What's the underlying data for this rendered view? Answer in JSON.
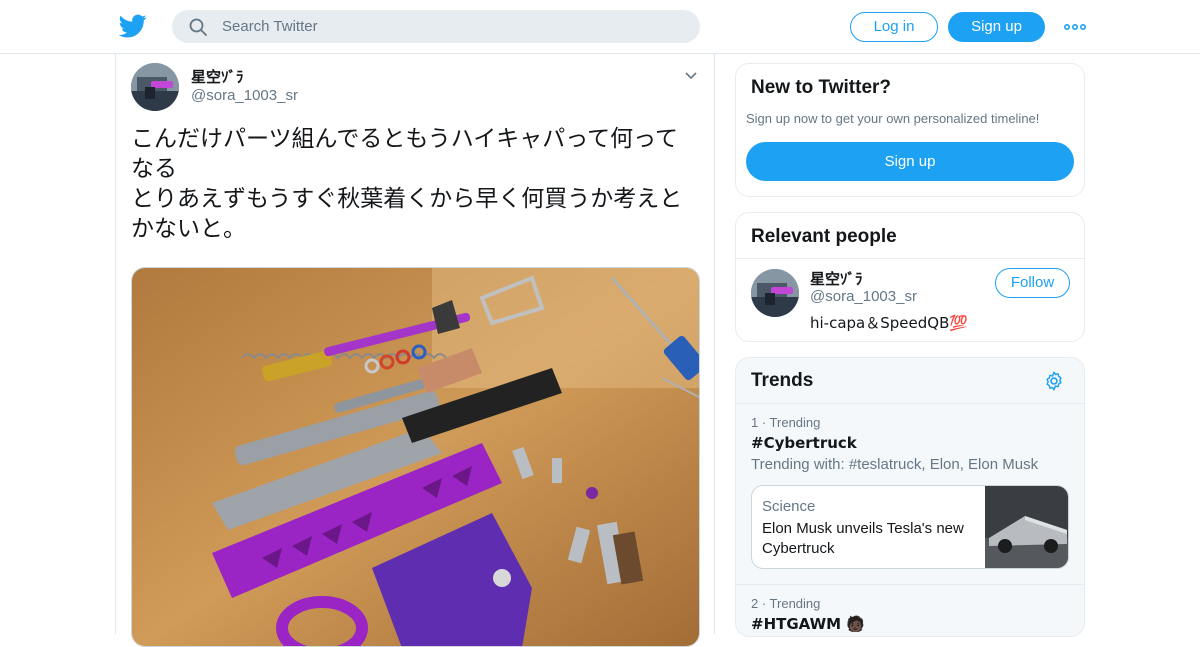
{
  "header": {
    "search_placeholder": "Search Twitter",
    "login_label": "Log in",
    "signup_label": "Sign up",
    "brand_color": "#1da1f2"
  },
  "tweet": {
    "name": "星空ｿﾞﾗ",
    "handle": "@sora_1003_sr",
    "text": "こんだけパーツ組んでるともうハイキャパって何ってなる\nとりあえずもうすぐ秋葉着くから早く何買うか考えとかないと。",
    "photo": "photo of disassembled airsoft pistol parts with purple frame and slide on a wooden table"
  },
  "new_to_twitter": {
    "title": "New to Twitter?",
    "subtitle": "Sign up now to get your own personalized timeline!",
    "button": "Sign up"
  },
  "relevant_people": {
    "title": "Relevant people",
    "name": "星空ｿﾞﾗ",
    "handle": "@sora_1003_sr",
    "bio": "hi-capa＆SpeedQB💯",
    "follow_label": "Follow"
  },
  "trends": {
    "title": "Trends",
    "items": [
      {
        "meta": "1 · Trending",
        "tag": "#Cybertruck",
        "with": "Trending with: #teslatruck, Elon, Elon Musk",
        "news_category": "Science",
        "news_headline": "Elon Musk unveils Tesla's new Cybertruck"
      },
      {
        "meta": "2 · Trending",
        "tag": "#HTGAWM 🧑🏿"
      }
    ]
  }
}
